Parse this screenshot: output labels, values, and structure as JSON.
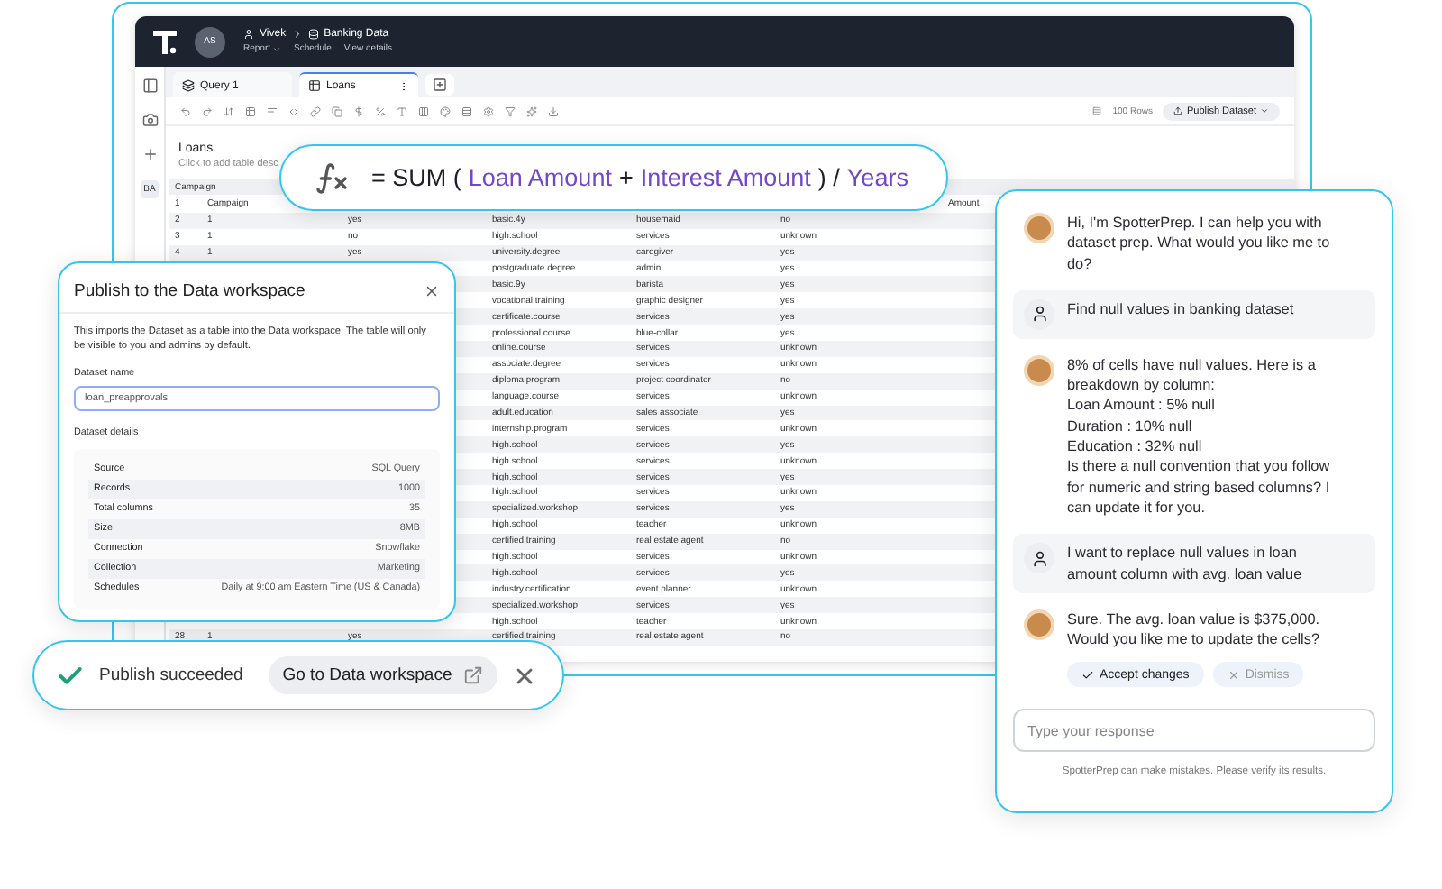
{
  "app": {
    "header": {
      "avatar_initials": "AS",
      "user": "Vivek",
      "dataset": "Banking Data",
      "menu": [
        {
          "label": "Report",
          "dropdown": true
        },
        {
          "label": "Schedule",
          "dropdown": false
        },
        {
          "label": "View details",
          "dropdown": false
        }
      ]
    },
    "sidebar": {
      "badge": "BA"
    },
    "tabs": [
      {
        "label": "Query 1",
        "selected": false
      },
      {
        "label": "Loans",
        "selected": true
      }
    ],
    "toolbar": {
      "row_count": "100 Rows",
      "publish_button": "Publish Dataset"
    },
    "table": {
      "title": "Loans",
      "description": "Click to add table desc",
      "columns": [
        {
          "label": "Campaign"
        }
      ],
      "rows": [
        {
          "number": "1",
          "column_2": "Campaign",
          "column_7": "Amount"
        },
        {
          "number": "2",
          "column_2": "1",
          "column_3": "yes",
          "column_4": "basic.4y",
          "column_5": "housemaid",
          "column_6": "no"
        },
        {
          "number": "3",
          "column_2": "1",
          "column_3": "no",
          "column_4": "high.school",
          "column_5": "services",
          "column_6": "unknown"
        },
        {
          "number": "4",
          "column_2": "1",
          "column_3": "yes",
          "column_4": "university.degree",
          "column_5": "caregiver",
          "column_6": "yes"
        },
        {
          "column_4": "postgraduate.degree",
          "column_5": "admin",
          "column_6": "yes"
        },
        {
          "column_4": "basic.9y",
          "column_5": "barista",
          "column_6": "yes"
        },
        {
          "column_4": "vocational.training",
          "column_5": "graphic designer",
          "column_6": "yes"
        },
        {
          "column_4": "certificate.course",
          "column_5": "services",
          "column_6": "yes"
        },
        {
          "column_4": "professional.course",
          "column_5": "blue-collar",
          "column_6": "yes"
        },
        {
          "column_4": "online.course",
          "column_5": "services",
          "column_6": "unknown"
        },
        {
          "column_4": "associate.degree",
          "column_5": "services",
          "column_6": "unknown"
        },
        {
          "column_4": "diploma.program",
          "column_5": "project coordinator",
          "column_6": "no"
        },
        {
          "column_4": "language.course",
          "column_5": "services",
          "column_6": "unknown"
        },
        {
          "column_4": "adult.education",
          "column_5": "sales associate",
          "column_6": "yes"
        },
        {
          "column_4": "internship.program",
          "column_5": "services",
          "column_6": "unknown"
        },
        {
          "column_4": "high.school",
          "column_5": "services",
          "column_6": "yes"
        },
        {
          "column_4": "high.school",
          "column_5": "services",
          "column_6": "unknown"
        },
        {
          "column_4": "high.school",
          "column_5": "services",
          "column_6": "yes"
        },
        {
          "column_4": "high.school",
          "column_5": "services",
          "column_6": "unknown"
        },
        {
          "column_4": "specialized.workshop",
          "column_5": "services",
          "column_6": "yes"
        },
        {
          "column_4": "high.school",
          "column_5": "teacher",
          "column_6": "unknown"
        },
        {
          "column_4": "certified.training",
          "column_5": "real estate agent",
          "column_6": "no"
        },
        {
          "column_4": "high.school",
          "column_5": "services",
          "column_6": "unknown"
        },
        {
          "column_4": "high.school",
          "column_5": "services",
          "column_6": "yes"
        },
        {
          "column_4": "industry.certification",
          "column_5": "event planner",
          "column_6": "unknown"
        },
        {
          "column_4": "specialized.workshop",
          "column_5": "services",
          "column_6": "yes"
        },
        {
          "column_4": "high.school",
          "column_5": "teacher",
          "column_6": "unknown"
        },
        {
          "number": "28",
          "column_2": "1",
          "column_3": "yes",
          "column_4": "certified.training",
          "column_5": "real estate agent",
          "column_6": "no"
        }
      ]
    }
  },
  "formula": {
    "tokens": [
      {
        "text": "= SUM (",
        "kind": "operator"
      },
      {
        "text": "Loan Amount",
        "kind": "field"
      },
      {
        "text": "+",
        "kind": "operator"
      },
      {
        "text": "Interest Amount",
        "kind": "field"
      },
      {
        "text": ") /",
        "kind": "operator"
      },
      {
        "text": "Years",
        "kind": "field"
      }
    ]
  },
  "publish_dialog": {
    "title": "Publish to the Data workspace",
    "description": "This imports the Dataset as a table into the Data workspace. The table will only be visible to you and admins by default.",
    "name_label": "Dataset name",
    "name_value": "loan_preapprovals",
    "details_label": "Dataset details",
    "details": [
      {
        "key": "Source",
        "value": "SQL Query"
      },
      {
        "key": "Records",
        "value": "1000"
      },
      {
        "key": "Total columns",
        "value": "35"
      },
      {
        "key": "Size",
        "value": "8MB"
      },
      {
        "key": "Connection",
        "value": "Snowflake"
      },
      {
        "key": "Collection",
        "value": "Marketing"
      },
      {
        "key": "Schedules",
        "value": "Daily at 9:00 am Eastern Time (US & Canada)"
      }
    ]
  },
  "toast": {
    "message": "Publish succeeded",
    "action": "Go to Data workspace"
  },
  "chat": {
    "messages": [
      {
        "kind": "bot",
        "text": "Hi, I'm SpotterPrep. I can help you with dataset prep. What would you like me to do?"
      },
      {
        "kind": "user",
        "text": "Find null values in banking dataset"
      },
      {
        "kind": "bot",
        "text": "8% of cells have null values. Here is a breakdown by column:\nLoan Amount : 5% null\nDuration : 10% null\nEducation : 32% null\nIs there a null convention that you follow for numeric and string based columns? I can update it for you."
      },
      {
        "kind": "user",
        "text": "I want to replace null values in loan amount column with avg. loan value"
      },
      {
        "kind": "bot",
        "text": "Sure. The avg. loan value is $375,000. Would you like me to update the cells?"
      }
    ],
    "actions": [
      {
        "label": "Accept changes",
        "kind": "accept"
      },
      {
        "label": "Dismiss",
        "kind": "dismiss"
      }
    ],
    "input": {
      "placeholder": "Type your response"
    },
    "disclaimer": "SpotterPrep can make mistakes. Please verify its results."
  }
}
